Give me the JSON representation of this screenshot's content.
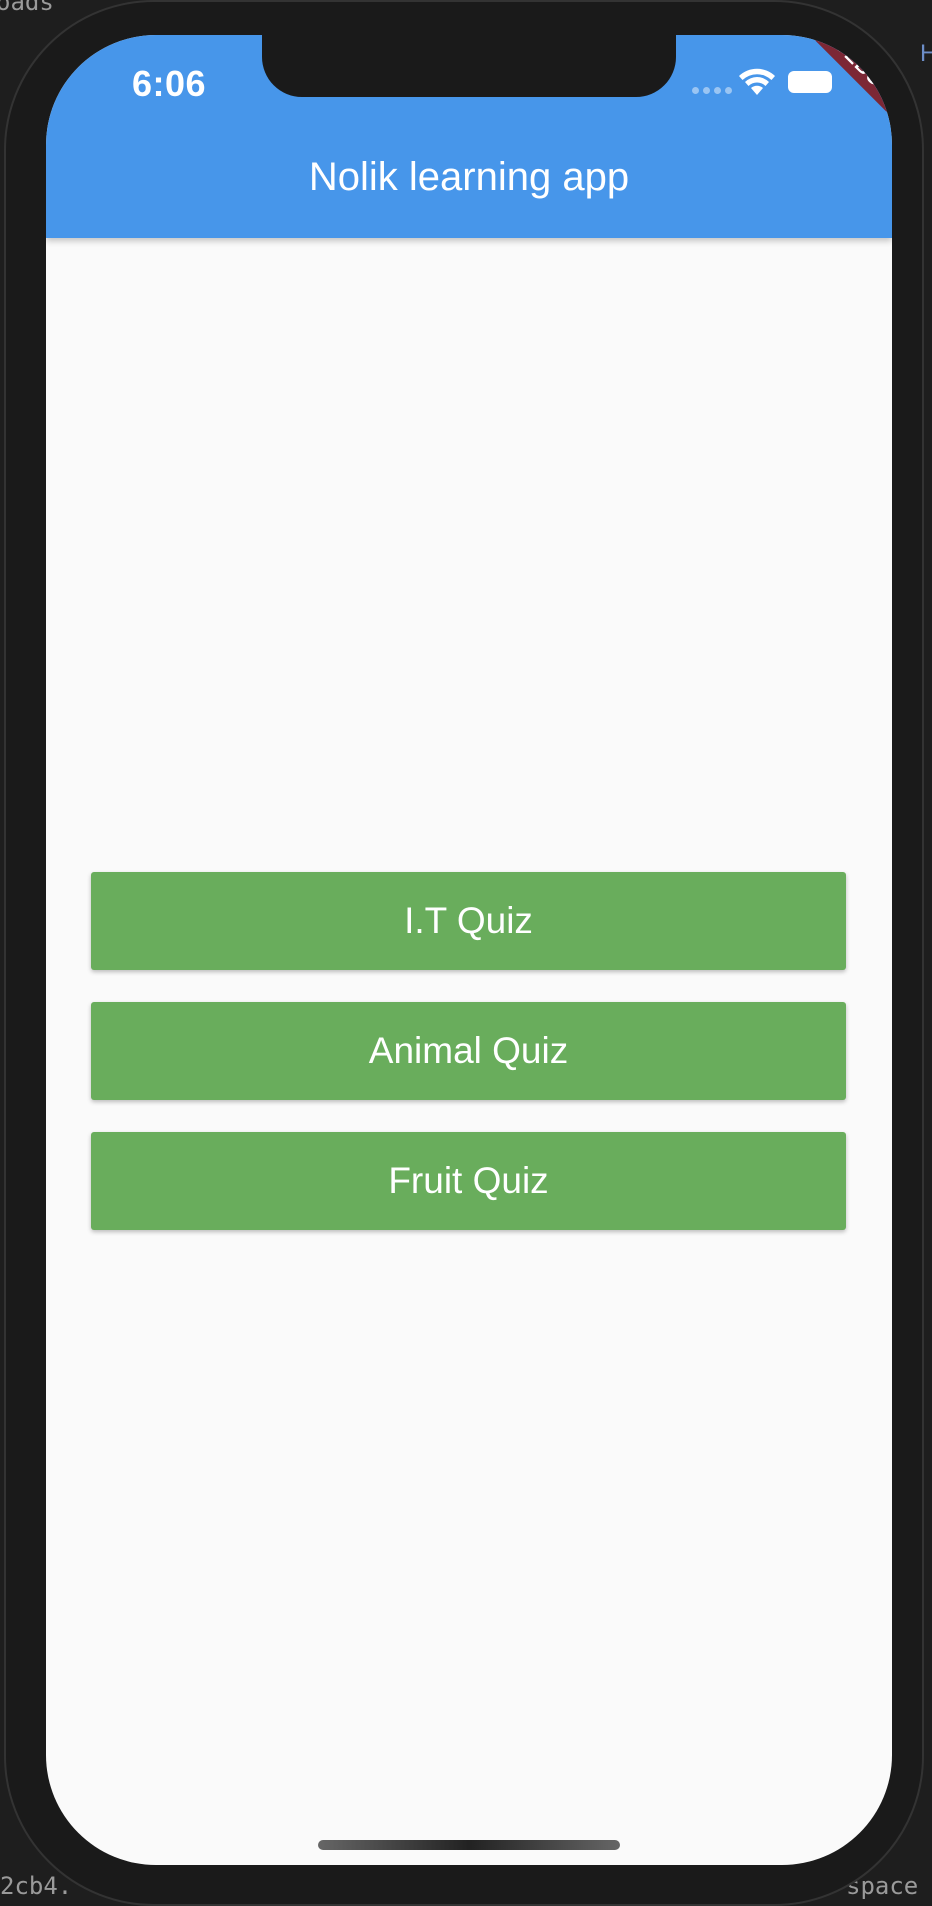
{
  "background": {
    "top_left_text": "oads",
    "top_right_text": "H",
    "bottom_left_text": "2cb4.",
    "bottom_right_text": "space"
  },
  "status_bar": {
    "time": "6:06",
    "debug_label": "DEBUG"
  },
  "app_bar": {
    "title": "Nolik learning app",
    "color": "#4796ea"
  },
  "quizzes": [
    {
      "label": "I.T Quiz"
    },
    {
      "label": "Animal Quiz"
    },
    {
      "label": "Fruit Quiz"
    }
  ],
  "colors": {
    "button": "#69ad5c",
    "debug_banner": "#7c2735",
    "screen": "#fafafa"
  }
}
